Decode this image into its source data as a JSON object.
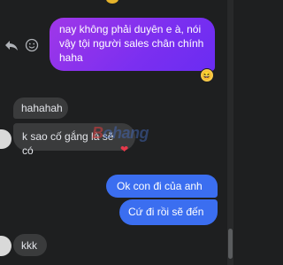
{
  "messages": {
    "outgoing_long": "nay không phải duyên e à, nói vậy tội người sales chân chính haha",
    "incoming_1": "hahahah",
    "incoming_2": "k sao cố gắng là sẽ có",
    "outgoing_1": "Ok con đi của anh",
    "outgoing_2": "Cứ đi rồi sẽ đến",
    "incoming_3": "kkk"
  },
  "reactions": {
    "outgoing_long_reaction": "😆",
    "incoming_2_reaction": "❤"
  },
  "watermark": {
    "prefix": "B",
    "rest": "ohang"
  },
  "colors": {
    "background": "#1e1f20",
    "outgoing_gradient_start": "#a037e8",
    "outgoing_gradient_end": "#6a2cf2",
    "outgoing_blue": "#3b6ef0",
    "incoming": "#3a3b3c"
  },
  "icons": {
    "reply": "reply-icon",
    "emoji": "emoji-react-icon"
  }
}
